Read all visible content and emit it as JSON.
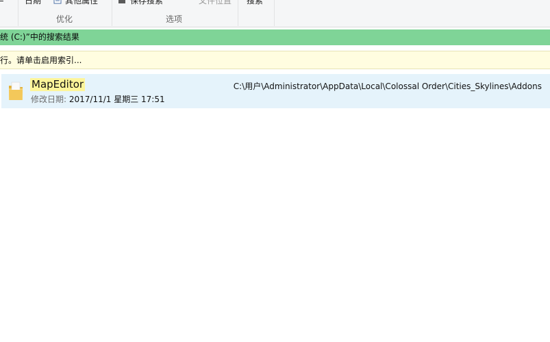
{
  "ribbon": {
    "date_label": "日期",
    "other_props_label": "其他属性",
    "save_search_label": "保存搜索",
    "file_location_label": "文件位置",
    "search_label": "搜索",
    "group_optimize": "优化",
    "group_options": "选项"
  },
  "info_bars": {
    "search_results_text": "统 (C:)”中的搜索结果",
    "index_notice_text": "行。请单击启用索引..."
  },
  "result": {
    "name": "MapEditor",
    "date_label": "修改日期:",
    "date_value": "2017/11/1 星期三 17:51",
    "path": "C:\\用户\\Administrator\\AppData\\Local\\Colossal Order\\Cities_Skylines\\Addons"
  },
  "colors": {
    "green_bar": "#7fd497",
    "yellow_bar": "#fffde0",
    "selected_row": "#e5f3fb",
    "highlight": "#fdf59a"
  }
}
